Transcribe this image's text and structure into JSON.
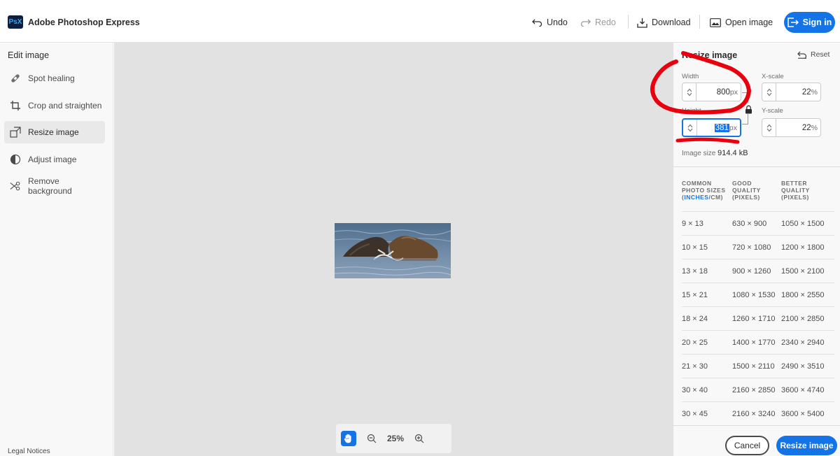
{
  "app": {
    "logo_text": "PsX",
    "title": "Adobe Photoshop Express"
  },
  "toolbar": {
    "undo_label": "Undo",
    "redo_label": "Redo",
    "download_label": "Download",
    "open_image_label": "Open image",
    "sign_in_label": "Sign in"
  },
  "sidebar": {
    "heading": "Edit image",
    "items": [
      {
        "label": "Spot healing",
        "icon": "bandage-icon",
        "active": false
      },
      {
        "label": "Crop and straighten",
        "icon": "crop-icon",
        "active": false
      },
      {
        "label": "Resize image",
        "icon": "resize-icon",
        "active": true
      },
      {
        "label": "Adjust image",
        "icon": "adjust-icon",
        "active": false
      },
      {
        "label": "Remove background",
        "icon": "scissors-icon",
        "active": false
      }
    ],
    "legal_label": "Legal Notices"
  },
  "canvas": {
    "zoom_value": "25%"
  },
  "resize_panel": {
    "title": "Resize image",
    "reset_label": "Reset",
    "width_label": "Width",
    "width_value": "800",
    "width_unit": "px",
    "height_label": "Height",
    "height_value": "381",
    "height_unit": "px",
    "xscale_label": "X-scale",
    "xscale_value": "22",
    "yscale_label": "Y-scale",
    "yscale_value": "22",
    "scale_unit": "%",
    "image_size_label": "Image size",
    "image_size_value": "914.4 kB"
  },
  "size_table": {
    "headers": {
      "col1_line1": "COMMON",
      "col1_line2": "PHOTO SIZES",
      "col1_inches": "INCHES",
      "col1_slash": "/",
      "col1_cm": "CM",
      "col1_open": "(",
      "col1_close": ")",
      "col2_line1": "GOOD",
      "col2_line2": "QUALITY",
      "col2_line3": "(PIXELS)",
      "col3_line1": "BETTER",
      "col3_line2": "QUALITY",
      "col3_line3": "(PIXELS)"
    },
    "rows": [
      {
        "size": "9 × 13",
        "good": "630 × 900",
        "better": "1050 × 1500"
      },
      {
        "size": "10 × 15",
        "good": "720 × 1080",
        "better": "1200 × 1800"
      },
      {
        "size": "13 × 18",
        "good": "900 × 1260",
        "better": "1500 × 2100"
      },
      {
        "size": "15 × 21",
        "good": "1080 × 1530",
        "better": "1800 × 2550"
      },
      {
        "size": "18 × 24",
        "good": "1260 × 1710",
        "better": "2100 × 2850"
      },
      {
        "size": "20 × 25",
        "good": "1400 × 1770",
        "better": "2340 × 2940"
      },
      {
        "size": "21 × 30",
        "good": "1500 × 2110",
        "better": "2490 × 3510"
      },
      {
        "size": "30 × 40",
        "good": "2160 × 2850",
        "better": "3600 × 4740"
      },
      {
        "size": "30 × 45",
        "good": "2160 × 3240",
        "better": "3600 × 5400"
      }
    ]
  },
  "actions": {
    "cancel_label": "Cancel",
    "resize_label": "Resize image"
  },
  "colors": {
    "accent": "#1473e6",
    "annotation": "#e8000f",
    "canvas_bg": "#e2e2e2"
  }
}
